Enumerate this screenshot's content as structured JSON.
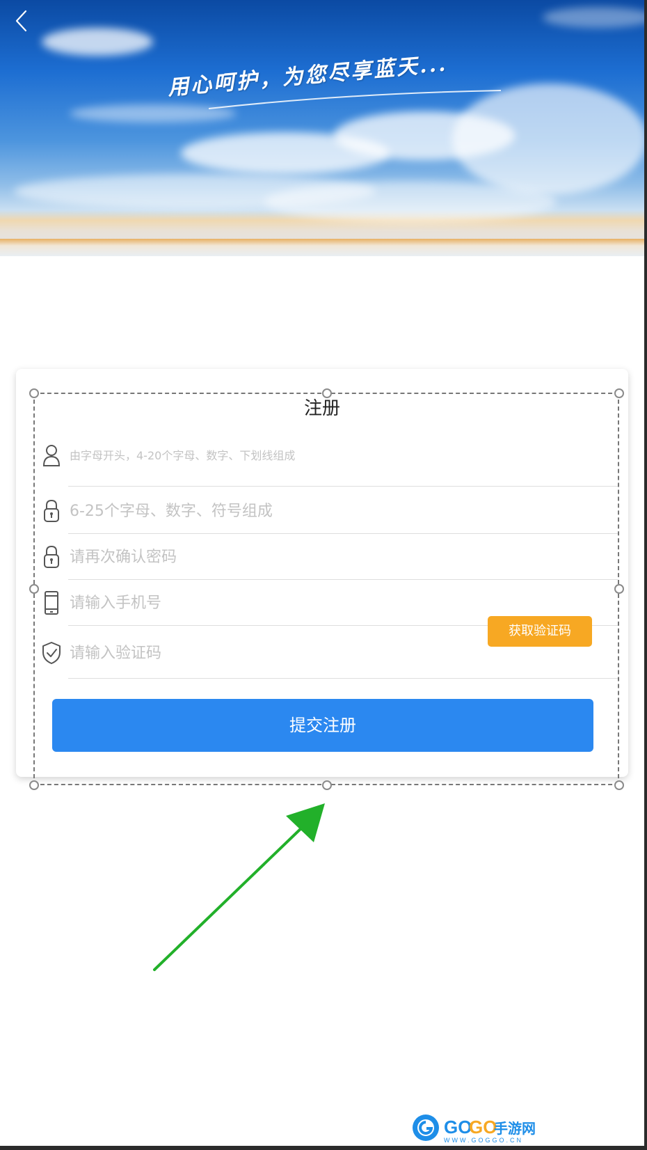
{
  "banner": {
    "slogan": "用心呵护，为您尽享蓝天..."
  },
  "form": {
    "title": "注册",
    "username_placeholder": "由字母开头，4-20个字母、数字、下划线组成",
    "password_placeholder": "6-25个字母、数字、符号组成",
    "confirm_password_placeholder": "请再次确认密码",
    "phone_placeholder": "请输入手机号",
    "code_placeholder": "请输入验证码",
    "get_code_button": "获取验证码",
    "submit_button": "提交注册"
  },
  "watermark": {
    "brand": "GOGO手游网",
    "url": "WWW.GOGGO.CN"
  },
  "colors": {
    "accent_blue": "#2b88f0",
    "code_button_orange": "#f7a823",
    "annotation_arrow_green": "#22b02a"
  },
  "icons": [
    "back-arrow-icon",
    "user-icon",
    "lock-icon",
    "phone-icon",
    "shield-check-icon"
  ]
}
